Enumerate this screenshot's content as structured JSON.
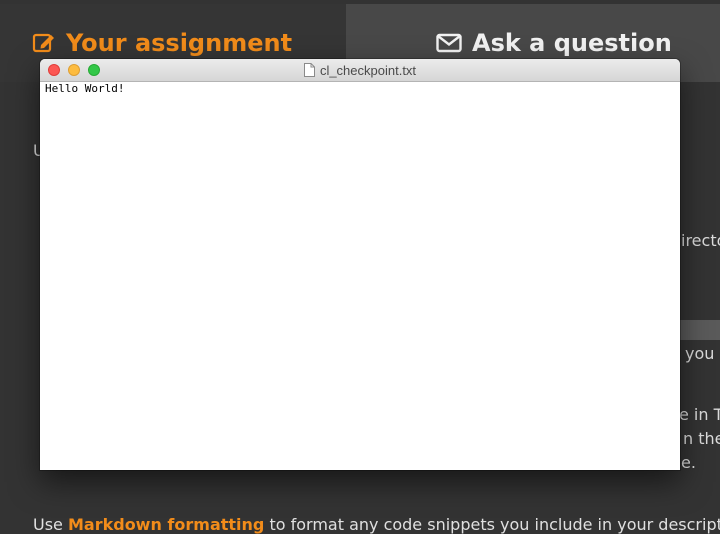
{
  "tabs": {
    "assignment_label": "Your assignment",
    "question_label": "Ask a question",
    "assignment_icon": "edit-icon",
    "question_icon": "envelope-icon"
  },
  "background_text": {
    "left_fragment": "U",
    "right_fragment_1": "irecto",
    "right_fragment_2": "you c",
    "right_fragment_3": "e in T",
    "right_fragment_4": "n the",
    "right_fragment_5": "e."
  },
  "footer": {
    "prefix": "Use ",
    "link": "Markdown formatting",
    "suffix": " to format any code snippets you include in your description. Her"
  },
  "window": {
    "title": "cl_checkpoint.txt",
    "content": "Hello World!"
  },
  "colors": {
    "accent": "#f28c1a",
    "background": "#333333",
    "question_tab": "#484848"
  }
}
